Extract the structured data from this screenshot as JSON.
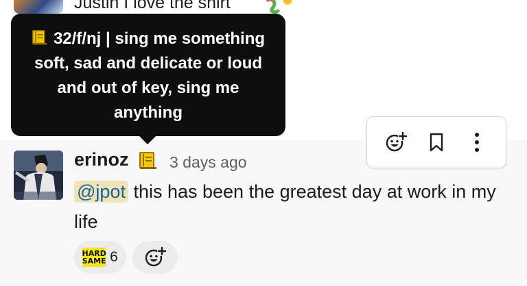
{
  "previous_message": {
    "text": "Justin I love the shirt",
    "icons": [
      "avatar",
      "dragon-emoji"
    ]
  },
  "tooltip": {
    "status_icon": "book-emoji",
    "text": "32/f/nj | sing me something soft, sad and delicate or loud and out of key, sing me anything"
  },
  "message": {
    "author": "erinoz",
    "status_icon": "book-emoji",
    "timestamp": "3 days ago",
    "mention": "@jpot",
    "text": " this has been the greatest day at work in my life",
    "reactions": [
      {
        "emoji_name": "hard-same",
        "emoji_line1": "HARD",
        "emoji_line2": "SAME",
        "count": "6"
      }
    ]
  },
  "toolbar": {
    "actions": [
      "add-reaction",
      "save-for-later",
      "more-actions"
    ]
  },
  "colors": {
    "tooltip_bg": "#0e0e0e",
    "highlight_row": "#f8f8f8",
    "mention_bg": "#f2e3b4",
    "mention_text": "#1264a3",
    "reaction_bg": "#ececec",
    "book_emoji": "#f5c400"
  }
}
